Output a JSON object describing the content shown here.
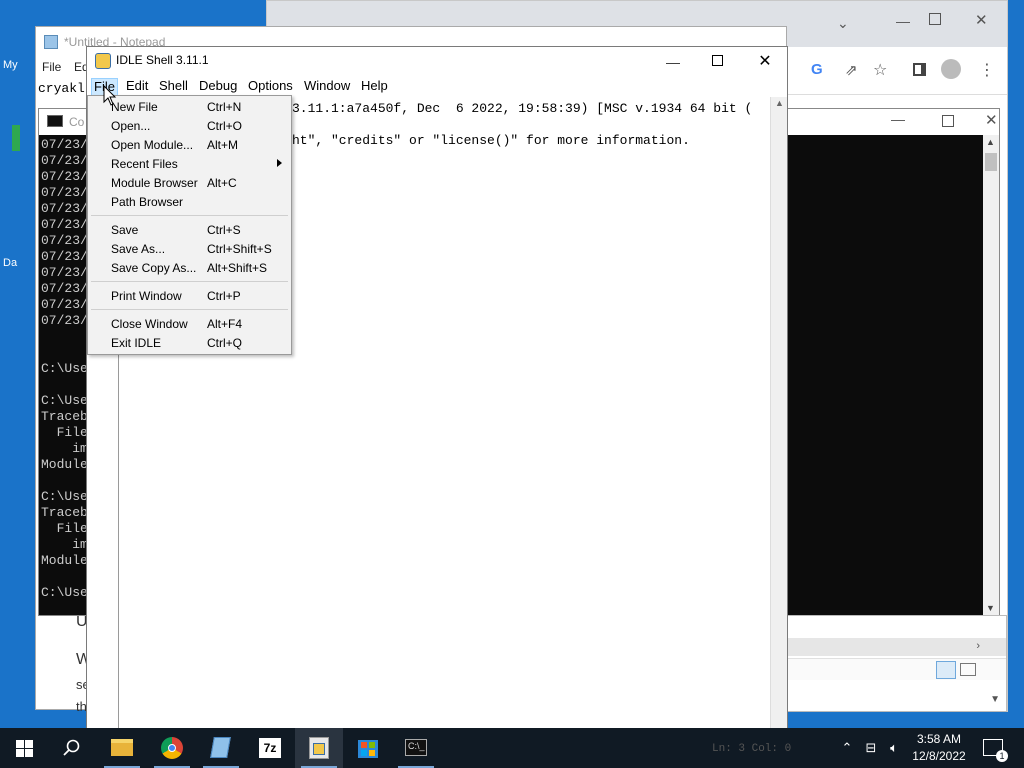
{
  "desktop": {
    "icon_labels": [
      "My",
      "Da"
    ]
  },
  "notepad": {
    "title": "*Untitled - Notepad",
    "menu": [
      "File",
      "Ed"
    ],
    "first_line": "cryakl"
  },
  "console": {
    "title": "Co",
    "lines": [
      "07/23/",
      "07/23/",
      "07/23/",
      "07/23/",
      "07/23/",
      "07/23/",
      "07/23/",
      "07/23/",
      "07/23/",
      "07/23/",
      "07/23/",
      "07/23/",
      "",
      "",
      "C:\\Use",
      "",
      "C:\\Use",
      "Traceb",
      "  File",
      "    im",
      "Module",
      "",
      "C:\\Use",
      "Traceb",
      "  File",
      "    im",
      "Module",
      "",
      "C:\\Use"
    ]
  },
  "behind_doc": {
    "lines": [
      "U",
      "W",
      "se",
      "th"
    ]
  },
  "idle": {
    "title": "IDLE Shell 3.11.1",
    "menu": [
      "File",
      "Edit",
      "Shell",
      "Debug",
      "Options",
      "Window",
      "Help"
    ],
    "shell_lines": [
      "3.11.1:a7a450f, Dec  6 2022, 19:58:39) [MSC v.1934 64 bit (",
      "ht\", \"credits\" or \"license()\" for more information."
    ],
    "status": "Ln: 3   Col: 0"
  },
  "file_menu": {
    "items": [
      {
        "label": "New File",
        "accel": "Ctrl+N"
      },
      {
        "label": "Open...",
        "accel": "Ctrl+O"
      },
      {
        "label": "Open Module...",
        "accel": "Alt+M"
      },
      {
        "label": "Recent Files",
        "accel": ""
      },
      {
        "label": "Module Browser",
        "accel": "Alt+C"
      },
      {
        "label": "Path Browser",
        "accel": ""
      },
      {
        "label": "Save",
        "accel": "Ctrl+S"
      },
      {
        "label": "Save As...",
        "accel": "Ctrl+Shift+S"
      },
      {
        "label": "Save Copy As...",
        "accel": "Alt+Shift+S"
      },
      {
        "label": "Print Window",
        "accel": "Ctrl+P"
      },
      {
        "label": "Close Window",
        "accel": "Alt+F4"
      },
      {
        "label": "Exit IDLE",
        "accel": "Ctrl+Q"
      }
    ]
  },
  "clock": {
    "time": "3:58 AM",
    "date": "12/8/2022"
  },
  "colors": {
    "desktop": "#1a73c9",
    "taskbar": "#101a24",
    "menu_highlight": "#cce8ff"
  }
}
